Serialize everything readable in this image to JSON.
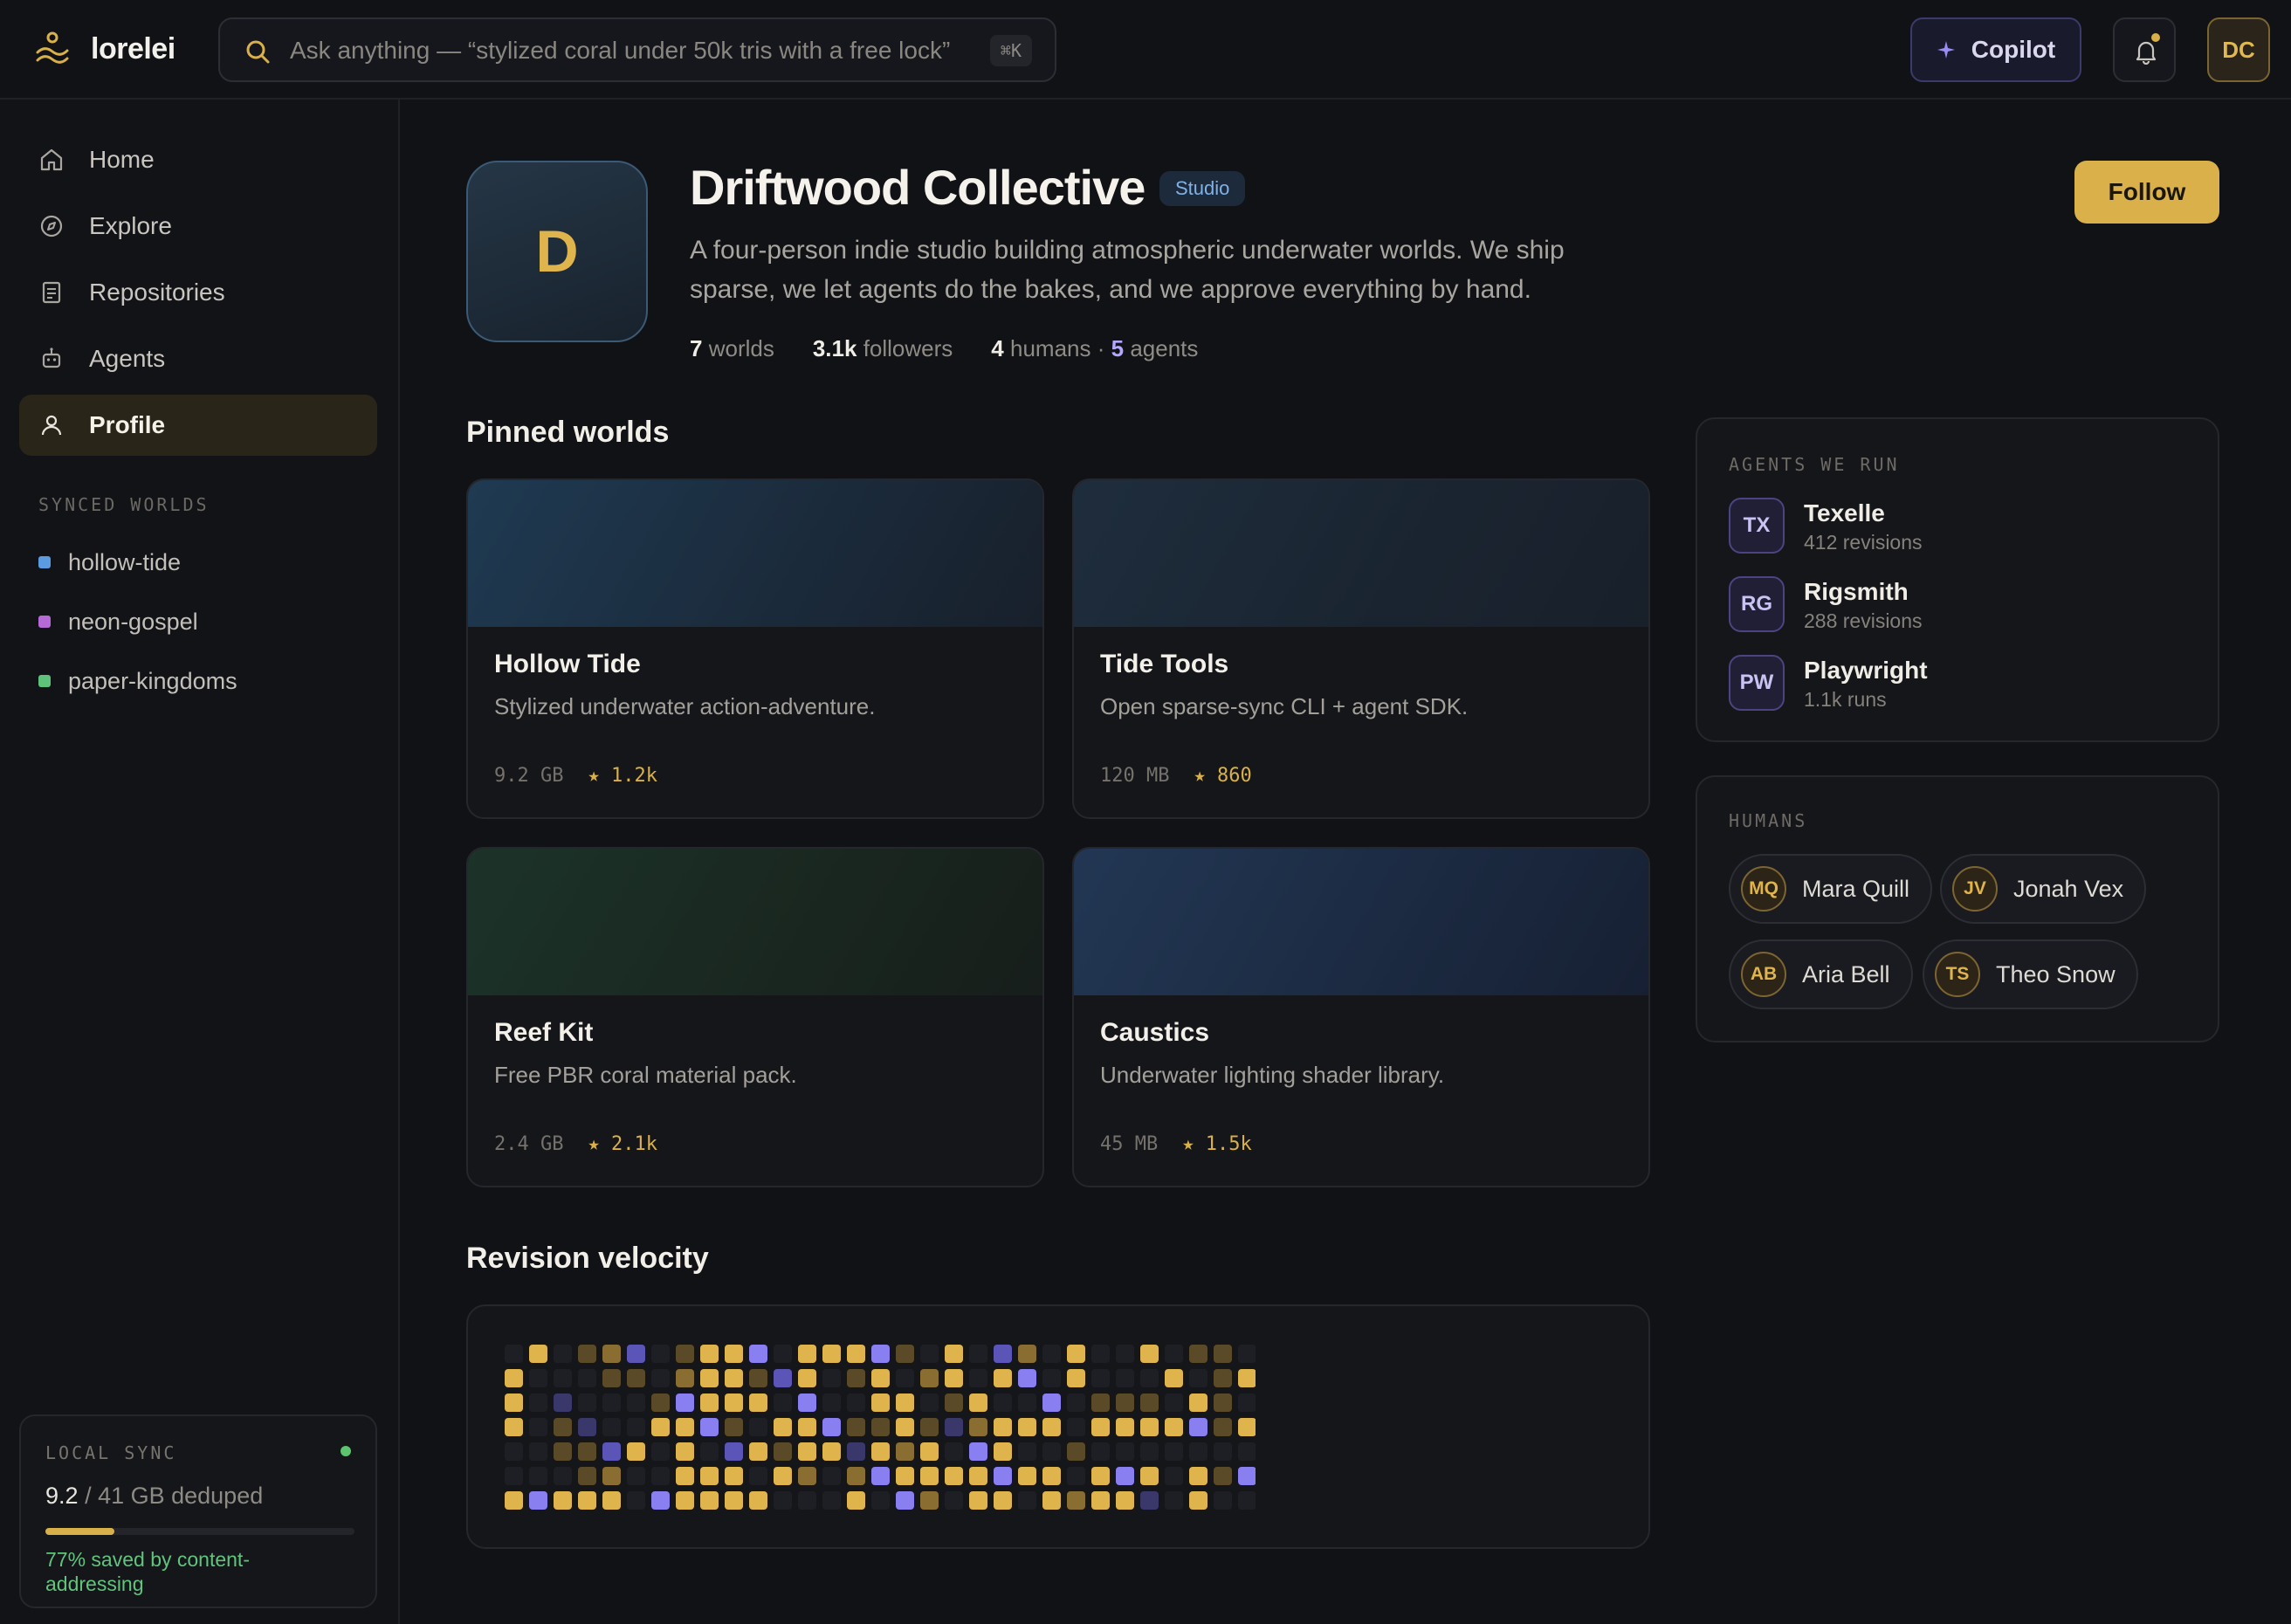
{
  "app": {
    "name": "lorelei"
  },
  "search": {
    "placeholder": "Ask anything — “stylized coral under 50k tris with a free lock”",
    "shortcut": "⌘K"
  },
  "header": {
    "copilot_label": "Copilot",
    "user_initials": "DC"
  },
  "sidebar": {
    "nav": [
      {
        "label": "Home",
        "icon": "home-icon"
      },
      {
        "label": "Explore",
        "icon": "compass-icon"
      },
      {
        "label": "Repositories",
        "icon": "document-icon"
      },
      {
        "label": "Agents",
        "icon": "robot-icon"
      },
      {
        "label": "Profile",
        "icon": "user-icon",
        "active": true
      }
    ],
    "synced_label": "SYNCED WORLDS",
    "synced_worlds": [
      {
        "name": "hollow-tide",
        "color": "#5b9be0"
      },
      {
        "name": "neon-gospel",
        "color": "#b56ad6"
      },
      {
        "name": "paper-kingdoms",
        "color": "#5fc27a"
      }
    ],
    "local_sync": {
      "label": "LOCAL SYNC",
      "used": "9.2",
      "total": "/ 41 GB deduped",
      "progress": 0.224,
      "note": "77% saved by content-addressing"
    }
  },
  "profile": {
    "initial": "D",
    "name": "Driftwood Collective",
    "badge": "Studio",
    "bio": "A four-person indie studio building atmospheric underwater worlds. We ship sparse, we let agents do the bakes, and we approve everything by hand.",
    "stats": {
      "worlds_count": "7",
      "worlds_label": "worlds",
      "followers_count": "3.1k",
      "followers_label": "followers",
      "humans_count": "4",
      "humans_label": "humans ·",
      "agents_count": "5",
      "agents_label": "agents"
    },
    "follow_label": "Follow"
  },
  "pinned": {
    "title": "Pinned worlds",
    "worlds": [
      {
        "title": "Hollow Tide",
        "desc": "Stylized underwater action-adventure.",
        "size": "9.2 GB",
        "stars": "★ 1.2k"
      },
      {
        "title": "Tide Tools",
        "desc": "Open sparse-sync CLI + agent SDK.",
        "size": "120 MB",
        "stars": "★ 860"
      },
      {
        "title": "Reef Kit",
        "desc": "Free PBR coral material pack.",
        "size": "2.4 GB",
        "stars": "★ 2.1k"
      },
      {
        "title": "Caustics",
        "desc": "Underwater lighting shader library.",
        "size": "45 MB",
        "stars": "★ 1.5k"
      }
    ]
  },
  "velocity": {
    "title": "Revision velocity",
    "colors": {
      "empty": "#1e1f24",
      "gold1": "#5a4a28",
      "gold2": "#8a6d30",
      "gold3": "#e0b44c",
      "violet1": "#3a386a",
      "violet2": "#5b55b8",
      "violet3": "#8a7ff0"
    },
    "grid": [
      "0301220133303333103022030030110",
      "3000110233123013023033030003013",
      "3010001333303003301300301110310",
      "3011003331033311311233303333313",
      "0011230302313313230330010000000",
      "0001200333032023333333303330313",
      "3333303333300030320330323310300"
    ]
  },
  "agents_panel": {
    "label": "AGENTS WE RUN",
    "agents": [
      {
        "initials": "TX",
        "name": "Texelle",
        "sub": "412 revisions"
      },
      {
        "initials": "RG",
        "name": "Rigsmith",
        "sub": "288 revisions"
      },
      {
        "initials": "PW",
        "name": "Playwright",
        "sub": "1.1k runs"
      }
    ]
  },
  "humans_panel": {
    "label": "HUMANS",
    "humans": [
      {
        "initials": "MQ",
        "name": "Mara Quill"
      },
      {
        "initials": "JV",
        "name": "Jonah Vex"
      },
      {
        "initials": "AB",
        "name": "Aria Bell"
      },
      {
        "initials": "TS",
        "name": "Theo Snow"
      }
    ]
  }
}
